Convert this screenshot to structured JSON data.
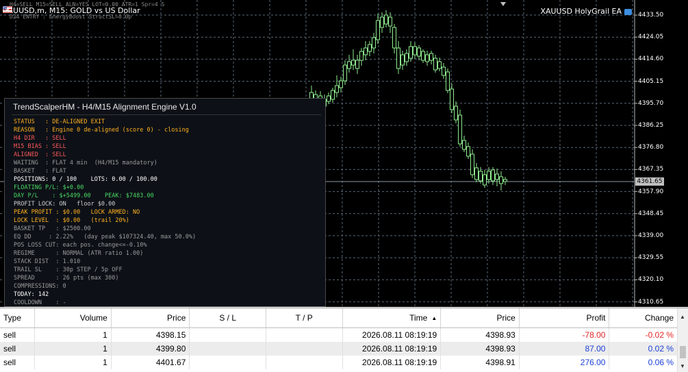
{
  "chart": {
    "symbol_title": "XAUUSD,m, M15: GOLD vs US Dollar",
    "ghost_line_1": "H4=SELL  M15=SELL  ALN=YES  LOT=0.00  ATR=1  Spr=4  S",
    "ghost_line_2": "D24 ENTRY    : EnergyBoost StructSL=0.0p",
    "ea_name": "XAUUSD HolyGrail EA",
    "current_price": "4361.65",
    "price_levels": [
      "4433.50",
      "4424.05",
      "4414.60",
      "4405.15",
      "4395.70",
      "4386.25",
      "4376.80",
      "4367.35",
      "4357.90",
      "4348.45",
      "4339.00",
      "4329.55",
      "4320.10",
      "4310.65"
    ],
    "bull_color": "#90ee90",
    "bear_color": "#ffffff",
    "grid_color": "#5a6a7a"
  },
  "panel": {
    "title": "TrendScalperHM - H4/M15 Alignment Engine V1.0",
    "rows": [
      {
        "text": "STATUS   : DE-ALIGNED EXIT",
        "color": "#ffb020"
      },
      {
        "text": "REASON   : Engine 0 de-aligned (score 0) - closing",
        "color": "#ffb020"
      },
      {
        "text": "H4 DIR   : SELL",
        "color": "#ff5a5a"
      },
      {
        "text": "M15 BIAS : SELL",
        "color": "#ff5a5a"
      },
      {
        "text": "ALIGNED  : SELL",
        "color": "#ff5a5a"
      },
      {
        "text": "WAITING  : FLAT 4 min  (H4/M15 mandatory)",
        "color": "#9a9a9a"
      },
      {
        "text": "BASKET   : FLAT",
        "color": "#9a9a9a"
      },
      {
        "text": "POSITIONS: 0 / 100    LOTS: 0.00 / 100.00",
        "color": "#ffffff"
      },
      {
        "text": "FLOATING P/L: $+0.00",
        "color": "#4cd964"
      },
      {
        "text": "DAY P/L    : $+5499.00    PEAK: $7483.00",
        "color": "#4cd964"
      },
      {
        "text": "PROFIT LOCK: ON   floor $0.00",
        "color": "#cfcfcf"
      },
      {
        "text": "PEAK PROFIT : $0.00   LOCK ARMED: NO",
        "color": "#ffb020"
      },
      {
        "text": "LOCK LEVEL  : $0.00   (trail 20%)",
        "color": "#ffb020"
      },
      {
        "text": "BASKET TP   : $2500.00",
        "color": "#9a9a9a"
      },
      {
        "text": "EQ DD     : 2.22%   (day peak $107324.40, max 50.0%)",
        "color": "#9a9a9a"
      },
      {
        "text": "POS LOSS CUT: each pos. change<=-0.10%",
        "color": "#9a9a9a"
      },
      {
        "text": "REGIME      : NORMAL (ATR ratio 1.00)",
        "color": "#9a9a9a"
      },
      {
        "text": "STACK DIST  : 1.010",
        "color": "#9a9a9a"
      },
      {
        "text": "TRAIL SL    : 30p STEP / 5p OFF",
        "color": "#9a9a9a"
      },
      {
        "text": "SPREAD      : 26 pts (max 300)",
        "color": "#9a9a9a"
      },
      {
        "text": "COMPRESSIONS: 0",
        "color": "#9a9a9a"
      },
      {
        "text": "TODAY: 142",
        "color": "#ffffff"
      },
      {
        "text": "COOLDOWN    : -",
        "color": "#9a9a9a"
      }
    ]
  },
  "terminal": {
    "headers": {
      "type": "Type",
      "volume": "Volume",
      "price": "Price",
      "sl": "S / L",
      "tp": "T / P",
      "time": "Time",
      "cur_price": "Price",
      "profit": "Profit",
      "change": "Change"
    },
    "sort_indicator": "▲",
    "rows": [
      {
        "type": "sell",
        "volume": "1",
        "price": "4398.15",
        "sl": "",
        "tp": "",
        "time": "2026.08.11 08:19:19",
        "cur_price": "4398.93",
        "profit": "-78.00",
        "change": "-0.02 %",
        "sign": "neg"
      },
      {
        "type": "sell",
        "volume": "1",
        "price": "4399.80",
        "sl": "",
        "tp": "",
        "time": "2026.08.11 08:19:19",
        "cur_price": "4398.93",
        "profit": "87.00",
        "change": "0.02 %",
        "sign": "pos"
      },
      {
        "type": "sell",
        "volume": "1",
        "price": "4401.67",
        "sl": "",
        "tp": "",
        "time": "2026.08.11 08:19:19",
        "cur_price": "4398.91",
        "profit": "276.00",
        "change": "0.06 %",
        "sign": "pos"
      }
    ]
  }
}
